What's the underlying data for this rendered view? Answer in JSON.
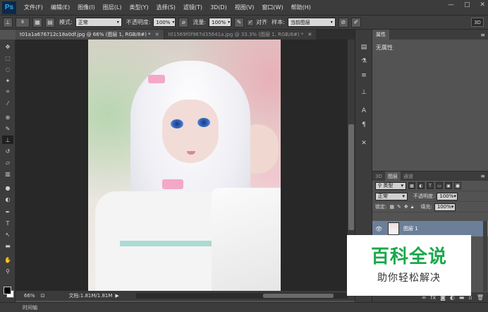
{
  "app": {
    "logo": "Ps",
    "menu": [
      "文件(F)",
      "编辑(E)",
      "图像(I)",
      "图层(L)",
      "类型(Y)",
      "选择(S)",
      "滤镜(T)",
      "3D(D)",
      "视图(V)",
      "窗口(W)",
      "帮助(H)"
    ],
    "window_controls": [
      "—",
      "□",
      "✕"
    ]
  },
  "options": {
    "brush_size": "8",
    "mode_label": "模式:",
    "mode_value": "正常",
    "opacity_label": "不透明度:",
    "opacity_value": "100%",
    "flow_label": "流量:",
    "flow_value": "100%",
    "aligned_label": "对齐",
    "sample_label": "样本:",
    "sample_value": "当前图层",
    "workspace": "3D"
  },
  "tabs": [
    {
      "label": "t01a1a676712c18a0df.jpg @ 66% (图层 1, RGB/8#) *",
      "active": true
    },
    {
      "label": "t01569f0f967d35641a.jpg @ 33.3% (图层 1, RGB/8#) *",
      "active": false
    }
  ],
  "status": {
    "zoom": "66%",
    "doc_info": "文档:1.81M/1.81M"
  },
  "timeline": {
    "label": "时间轴"
  },
  "properties": {
    "tab": "属性",
    "body": "无属性"
  },
  "layers": {
    "tabs": [
      "3D",
      "图层",
      "通道"
    ],
    "active_tab": "图层",
    "filter_label": "类型",
    "blend_mode": "正常",
    "opacity_label": "不透明度:",
    "opacity_value": "100%",
    "lock_label": "锁定:",
    "fill_label": "填充:",
    "fill_value": "100%",
    "layer_name": "图层 1"
  },
  "watermark": {
    "title": "百科全说",
    "subtitle": "助你轻松解决"
  },
  "colors": {
    "watermark_green": "#1aa84c",
    "selected_layer": "#6b7f99"
  }
}
